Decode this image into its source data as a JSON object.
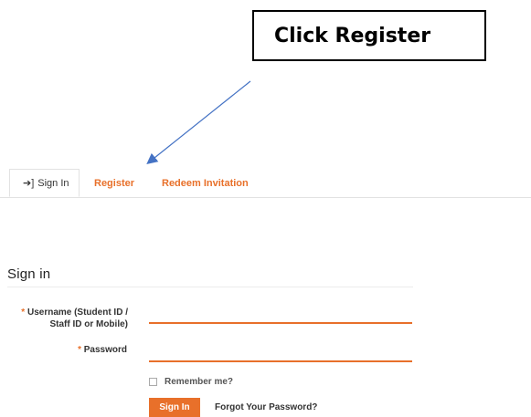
{
  "annotation": {
    "callout_text": "Click Register",
    "arrow_color": "#4472c4"
  },
  "tabs": [
    {
      "label": "Sign In",
      "icon": "sign-in-icon",
      "active": true
    },
    {
      "label": "Register",
      "active": false
    },
    {
      "label": "Redeem Invitation",
      "active": false
    }
  ],
  "signin": {
    "title": "Sign in",
    "username_label": "Username (Student ID / Staff ID or Mobile)",
    "username_value": "",
    "password_label": "Password",
    "password_value": "",
    "required_marker": "*",
    "remember_label": "Remember me?",
    "remember_checked": false,
    "submit_label": "Sign In",
    "forgot_label": "Forgot Your Password?"
  },
  "colors": {
    "accent": "#e8702a",
    "border": "#e2e2e2"
  }
}
